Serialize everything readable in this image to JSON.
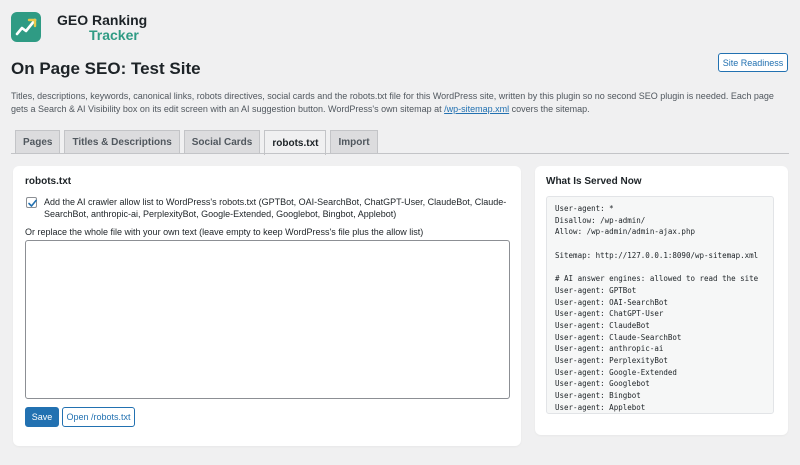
{
  "brand": {
    "line1": "GEO Ranking",
    "line2": "Tracker",
    "accent_color": "#2f9b84",
    "icon": "trend-chart-icon"
  },
  "header": {
    "title": "On Page SEO: Test Site",
    "site_readiness_label": "Site Readiness",
    "description_part1": "Titles, descriptions, keywords, canonical links, robots directives, social cards and the robots.txt file for this WordPress site, written by this plugin so no second SEO plugin is needed. Each page gets a Search & AI Visibility box on its edit screen with an AI suggestion button. WordPress's own sitemap at ",
    "sitemap_link": "/wp-sitemap.xml",
    "description_part2": " covers the sitemap."
  },
  "tabs": [
    {
      "label": "Pages",
      "active": false
    },
    {
      "label": "Titles & Descriptions",
      "active": false
    },
    {
      "label": "Social Cards",
      "active": false
    },
    {
      "label": "robots.txt",
      "active": true
    },
    {
      "label": "Import",
      "active": false
    }
  ],
  "robots_panel": {
    "heading": "robots.txt",
    "checkbox_checked": true,
    "checkbox_label": "Add the AI crawler allow list to WordPress's robots.txt (GPTBot, OAI-SearchBot, ChatGPT-User, ClaudeBot, Claude-SearchBot, anthropic-ai, PerplexityBot, Google-Extended, Googlebot, Bingbot, Applebot)",
    "replace_label": "Or replace the whole file with your own text (leave empty to keep WordPress's file plus the allow list)",
    "textarea_value": "",
    "save_label": "Save",
    "open_label": "Open /robots.txt"
  },
  "served_panel": {
    "heading": "What Is Served Now",
    "lines": [
      "User-agent: *",
      "Disallow: /wp-admin/",
      "Allow: /wp-admin/admin-ajax.php",
      "",
      "Sitemap: http://127.0.0.1:8090/wp-sitemap.xml",
      "",
      "# AI answer engines: allowed to read the site",
      "User-agent: GPTBot",
      "User-agent: OAI-SearchBot",
      "User-agent: ChatGPT-User",
      "User-agent: ClaudeBot",
      "User-agent: Claude-SearchBot",
      "User-agent: anthropic-ai",
      "User-agent: PerplexityBot",
      "User-agent: Google-Extended",
      "User-agent: Googlebot",
      "User-agent: Bingbot",
      "User-agent: Applebot"
    ]
  },
  "colors": {
    "primary": "#2271b1",
    "page_bg": "#f0f0f1"
  }
}
